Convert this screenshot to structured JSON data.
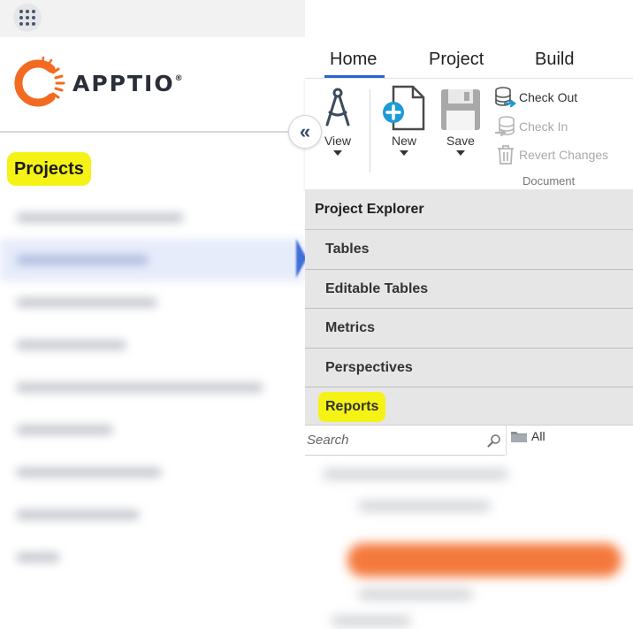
{
  "left_nav": {
    "brand": {
      "name": "APPTIO",
      "reg_mark": "®",
      "brand_color": "#f26b21"
    },
    "projects_heading": "Projects",
    "highlight_color": "#f5f216",
    "collapse_glyph": "«"
  },
  "ribbon": {
    "tabs": [
      {
        "label": "Home",
        "active": true
      },
      {
        "label": "Project",
        "active": false
      },
      {
        "label": "Build",
        "active": false
      }
    ],
    "buttons": {
      "view": "View",
      "new": "New",
      "save": "Save"
    },
    "document_group": {
      "check_out": "Check Out",
      "check_in": "Check In",
      "revert": "Revert Changes",
      "label": "Document"
    },
    "accent_color": "#2b64d1"
  },
  "explorer": {
    "header": "Project Explorer",
    "items": [
      "Tables",
      "Editable Tables",
      "Metrics",
      "Perspectives",
      "Reports"
    ],
    "highlighted_item": "Reports"
  },
  "search": {
    "placeholder": "Search",
    "folder_filter": "All"
  },
  "icons": {
    "app_launcher": "grid-dots-icon",
    "collapse": "double-chevron-left-icon",
    "view": "compass-icon",
    "new": "new-document-plus-icon",
    "save": "floppy-disk-icon",
    "check_out": "database-arrow-out-icon",
    "check_in": "database-arrow-in-icon",
    "revert": "trash-can-icon",
    "search": "magnifier-icon",
    "folder": "folder-icon"
  }
}
